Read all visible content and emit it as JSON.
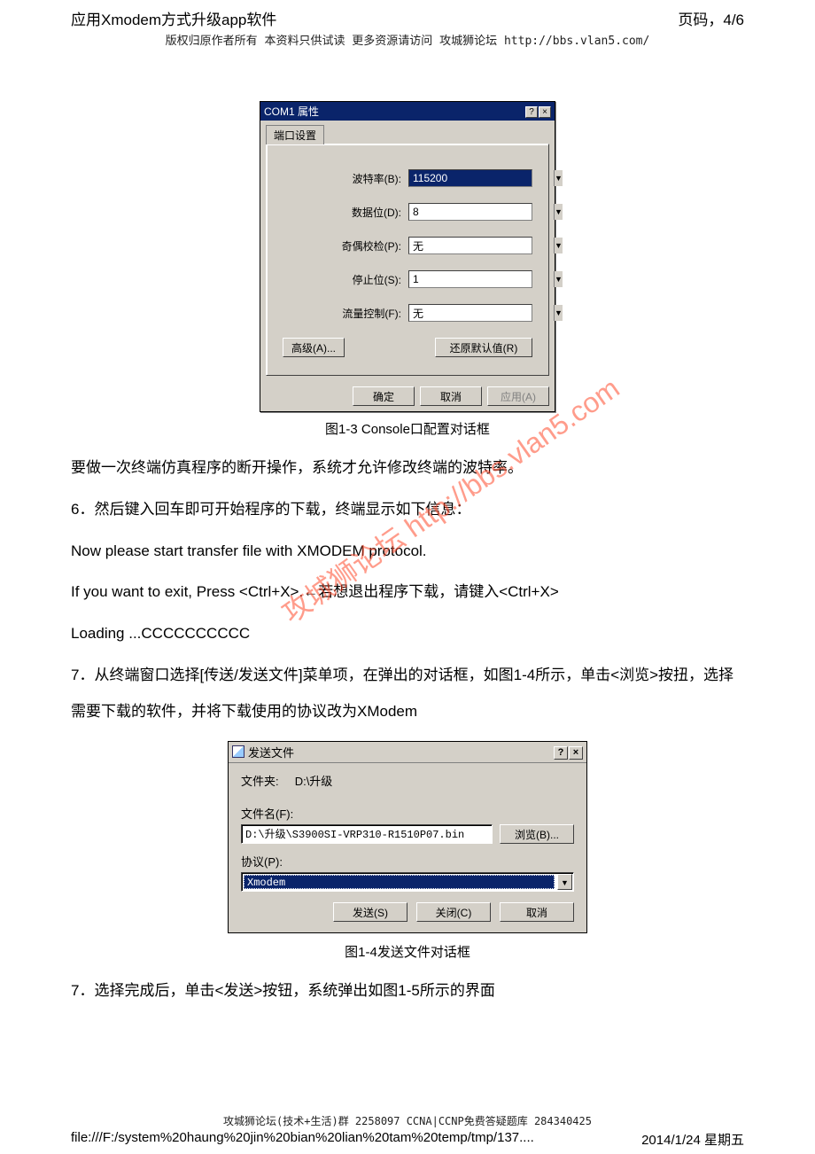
{
  "header": {
    "title": "应用Xmodem方式升级app软件",
    "page_indicator": "页码，4/6",
    "copyright": "版权归原作者所有 本资料只供试读 更多资源请访问 攻城狮论坛 http://bbs.vlan5.com/"
  },
  "dialog1": {
    "title": "COM1 属性",
    "tab": "端口设置",
    "fields": {
      "baud_label": "波特率(B):",
      "baud_value": "115200",
      "data_label": "数据位(D):",
      "data_value": "8",
      "parity_label": "奇偶校检(P):",
      "parity_value": "无",
      "stop_label": "停止位(S):",
      "stop_value": "1",
      "flow_label": "流量控制(F):",
      "flow_value": "无"
    },
    "buttons": {
      "advanced": "高级(A)...",
      "restore": "还原默认值(R)",
      "ok": "确定",
      "cancel": "取消",
      "apply": "应用(A)"
    }
  },
  "caption1": "图1-3 Console口配置对话框",
  "body": {
    "p1": "要做一次终端仿真程序的断开操作，系统才允许修改终端的波特率。",
    "p2": "6．然后键入回车即可开始程序的下载，终端显示如下信息：",
    "p3": "Now please start transfer file with XMODEM protocol.",
    "p4": "If you want to exit, Press <Ctrl+X>.←若想退出程序下载，请键入<Ctrl+X>",
    "p5": "Loading ...CCCCCCCCCC",
    "p6": "7．从终端窗口选择[传送/发送文件]菜单项，在弹出的对话框，如图1-4所示，单击<浏览>按扭，选择需要下载的软件，并将下载使用的协议改为XModem"
  },
  "watermark": "攻城狮论坛 http://bbs.vlan5.com",
  "dialog2": {
    "title": "发送文件",
    "folder_label": "文件夹:",
    "folder_value": "D:\\升级",
    "filename_label": "文件名(F):",
    "filename_value": "D:\\升级\\S3900SI-VRP310-R1510P07.bin",
    "browse": "浏览(B)...",
    "protocol_label": "协议(P):",
    "protocol_value": "Xmodem",
    "buttons": {
      "send": "发送(S)",
      "close": "关闭(C)",
      "cancel": "取消"
    }
  },
  "caption2": "图1-4发送文件对话框",
  "body2": {
    "p7": "7．选择完成后，单击<发送>按钮，系统弹出如图1-5所示的界面"
  },
  "footer": {
    "small": "攻城狮论坛(技术+生活)群 2258097 CCNA|CCNP免费答疑题库 284340425",
    "path": "file:///F:/system%20haung%20jin%20bian%20lian%20tam%20temp/tmp/137....",
    "date": "2014/1/24 星期五"
  }
}
